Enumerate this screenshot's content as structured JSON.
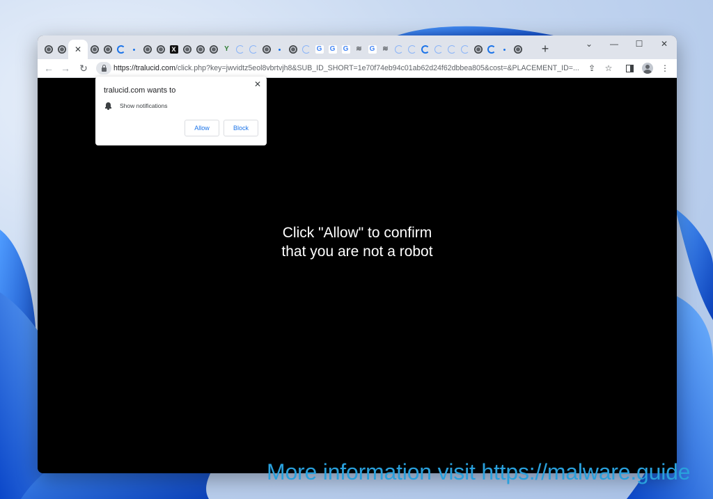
{
  "browser": {
    "tabs": [
      {
        "icon": "globe-icon"
      },
      {
        "icon": "globe-icon"
      },
      {
        "icon": "close-icon",
        "active": true
      },
      {
        "icon": "globe-icon"
      },
      {
        "icon": "globe-icon"
      },
      {
        "icon": "loading-icon"
      },
      {
        "icon": "dot-icon"
      },
      {
        "icon": "globe-icon"
      },
      {
        "icon": "globe-icon"
      },
      {
        "icon": "x-logo-icon"
      },
      {
        "icon": "globe-icon"
      },
      {
        "icon": "globe-icon"
      },
      {
        "icon": "globe-icon"
      },
      {
        "icon": "yandex-icon"
      },
      {
        "icon": "loading-light-icon"
      },
      {
        "icon": "loading-light-icon"
      },
      {
        "icon": "globe-icon"
      },
      {
        "icon": "dot-icon"
      },
      {
        "icon": "globe-icon"
      },
      {
        "icon": "loading-light-icon"
      },
      {
        "icon": "google-icon"
      },
      {
        "icon": "google-icon"
      },
      {
        "icon": "google-icon"
      },
      {
        "icon": "wifi-icon"
      },
      {
        "icon": "google-icon"
      },
      {
        "icon": "wifi-icon"
      },
      {
        "icon": "loading-light-icon"
      },
      {
        "icon": "loading-light-icon"
      },
      {
        "icon": "loading-icon"
      },
      {
        "icon": "loading-light-icon"
      },
      {
        "icon": "loading-light-icon"
      },
      {
        "icon": "loading-light-icon"
      },
      {
        "icon": "globe-icon"
      },
      {
        "icon": "loading-icon"
      },
      {
        "icon": "dot-icon"
      },
      {
        "icon": "globe-icon"
      }
    ],
    "new_tab_glyph": "+",
    "window_controls": {
      "chevron": "⌄",
      "minimize": "—",
      "maximize": "☐",
      "close": "✕"
    },
    "url_host": "https://tralucid.com",
    "url_path": "/click.php?key=jwvidtz5eol8vbrtvjh8&SUB_ID_SHORT=1e70f74eb94c01ab62d24f62dbbea805&cost=&PLACEMENT_ID=..."
  },
  "popup": {
    "title": "tralucid.com wants to",
    "permission": "Show notifications",
    "allow_label": "Allow",
    "block_label": "Block",
    "close_glyph": "✕"
  },
  "page": {
    "line1": "Click \"Allow\" to confirm",
    "line2": "that you are not a robot"
  },
  "watermark": "More information visit https://malware.guide",
  "colors": {
    "accent": "#1a73e8",
    "watermark": "#29a0dc",
    "desktop_bloom": "#1565d8"
  }
}
